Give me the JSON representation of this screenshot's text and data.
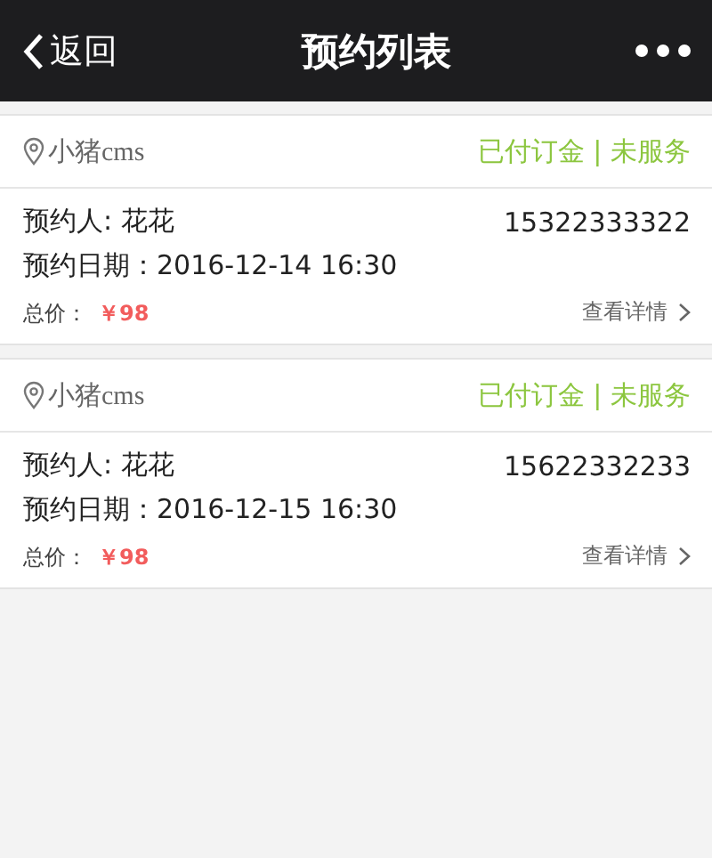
{
  "nav_bar": {
    "back_label": "返回",
    "title": "预约列表"
  },
  "orders": [
    {
      "shop": "小猪cms",
      "status": "已付订金 | 未服务",
      "booker": "预约人: 花花",
      "phone": "15322333322",
      "date": "预约日期：2016-12-14 16:30",
      "total_label": "总价：",
      "total": "￥98",
      "details_link": "查看详情"
    },
    {
      "shop": "小猪cms",
      "status": "已付订金 | 未服务",
      "booker": "预约人: 花花",
      "phone": "15622332233",
      "date": "预约日期：2016-12-15 16:30",
      "total_label": "总价：",
      "total": "￥98",
      "details_link": "查看详情"
    }
  ]
}
